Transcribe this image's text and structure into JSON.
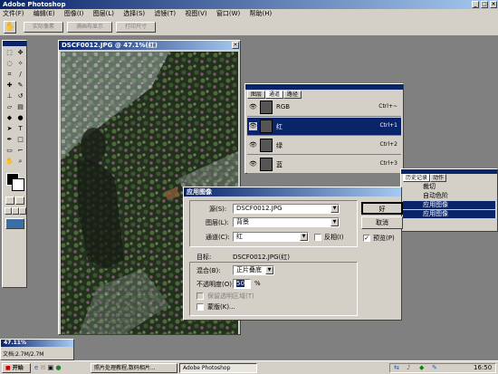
{
  "app": {
    "title": "Adobe Photoshop"
  },
  "menu": [
    "文件(F)",
    "编辑(E)",
    "图像(I)",
    "图层(L)",
    "选择(S)",
    "滤镜(T)",
    "视图(V)",
    "窗口(W)",
    "帮助(H)"
  ],
  "options": {
    "buttons": [
      "实际像素",
      "满画布显示",
      "打印尺寸"
    ]
  },
  "image_window": {
    "title": "DSCF0012.JPG @ 47.1%(红)"
  },
  "channels": {
    "tabs": [
      "图层",
      "通道",
      "路径"
    ],
    "rows": [
      {
        "name": "RGB",
        "key": "Ctrl+~"
      },
      {
        "name": "红",
        "key": "Ctrl+1"
      },
      {
        "name": "绿",
        "key": "Ctrl+2"
      },
      {
        "name": "蓝",
        "key": "Ctrl+3"
      }
    ]
  },
  "history": {
    "tabs": [
      "历史记录",
      "动作"
    ],
    "items": [
      "裁切",
      "自动色阶",
      "应用图像",
      "应用图像"
    ]
  },
  "dialog": {
    "title": "应用图像",
    "source_label": "源(S):",
    "source_value": "DSCF0012.JPG",
    "layer_label": "图层(L):",
    "layer_value": "背景",
    "channel_label": "通道(C):",
    "channel_value": "红",
    "invert_label": "反相(I)",
    "target_label": "目标:",
    "target_value": "DSCF0012.JPG(红)",
    "blend_label": "混合(B):",
    "blend_value": "正片叠底",
    "opacity_label": "不透明度(O):",
    "opacity_value": "50",
    "opacity_unit": "%",
    "preserve_label": "保留透明区域(T)",
    "mask_label": "蒙版(K)...",
    "ok_label": "好",
    "cancel_label": "取消",
    "preview_label": "预览(P)"
  },
  "status": {
    "title": "47.11%",
    "doc": "文档:2.7M/2.7M"
  },
  "taskbar": {
    "start": "开始",
    "tasks": [
      "照片处理教程,数码相片...",
      "Adobe Photoshop"
    ],
    "clock": "16:50"
  }
}
